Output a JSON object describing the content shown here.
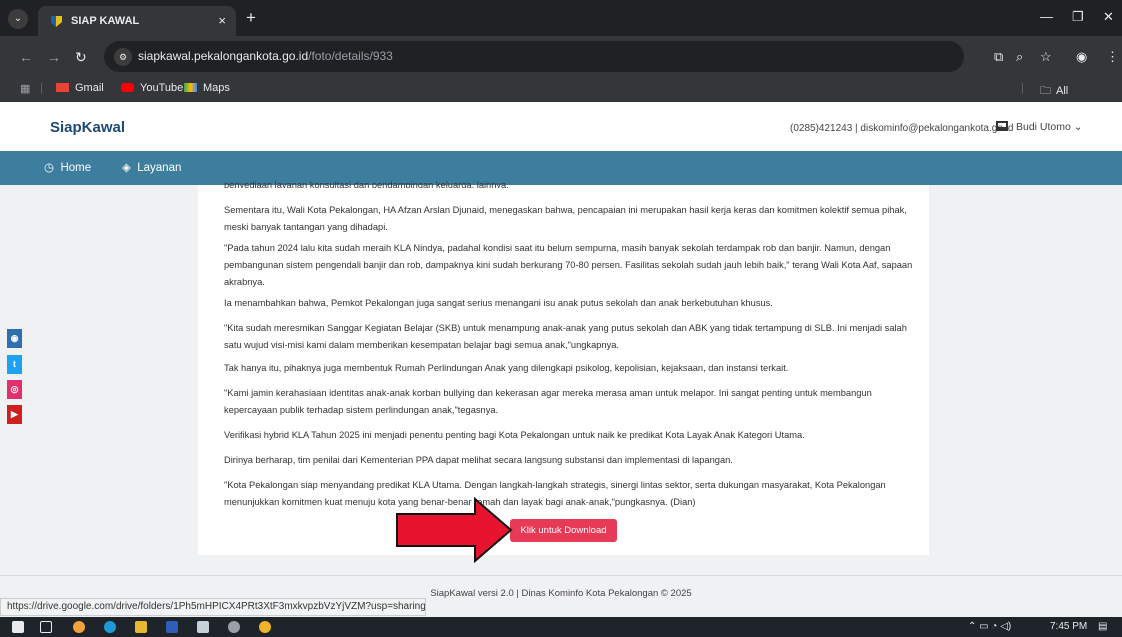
{
  "browser": {
    "tab_title": "SIAP KAWAL",
    "url_host": "siapkawal.pekalongankota.go.id",
    "url_path": "/foto/details/933",
    "bookmarks": [
      "Gmail",
      "YouTube",
      "Maps"
    ],
    "all_bookmarks": "All Bookmarks",
    "icons": [
      "tab-search-icon",
      "close-icon",
      "new-tab-icon",
      "minimize-icon",
      "restore-icon",
      "back-icon",
      "forward-icon",
      "reload-icon",
      "site-info-icon",
      "translate-icon",
      "zoom-icon",
      "star-icon",
      "profile-icon",
      "menu-icon",
      "apps-grid-icon",
      "folder-icon"
    ]
  },
  "site": {
    "brand": "SiapKawal",
    "contact": "(0285)421243 | diskominfo@pekalongankota.go.id",
    "user": "Budi Utomo",
    "nav": [
      "Home",
      "Layanan"
    ]
  },
  "article": {
    "cut_top": "penyediaan layanan konsultasi dan pendampingan keluarga, lainnya.",
    "paragraphs": [
      "Sementara itu, Wali Kota Pekalongan, HA Afzan Arslan Djunaid, menegaskan bahwa, pencapaian ini merupakan hasil kerja keras dan komitmen kolektif semua pihak, meski banyak tantangan yang dihadapi.",
      "\"Pada tahun 2024 lalu kita sudah meraih KLA Nindya, padahal kondisi saat itu belum sempurna, masih banyak sekolah terdampak rob dan banjir. Namun, dengan pembangunan sistem pengendali banjir dan rob, dampaknya kini sudah berkurang 70-80 persen. Fasilitas sekolah sudah jauh lebih baik,\" terang Wali Kota Aaf, sapaan akrabnya.",
      "Ia menambahkan bahwa, Pemkot Pekalongan juga sangat serius menangani isu anak putus sekolah dan anak berkebutuhan khusus.",
      "\"Kita sudah meresmikan Sanggar Kegiatan Belajar (SKB) untuk menampung anak-anak yang putus sekolah dan ABK yang tidak tertampung di SLB. Ini menjadi salah satu wujud visi-misi kami dalam memberikan kesempatan belajar bagi semua anak,\"ungkapnya.",
      "Tak hanya itu, pihaknya juga membentuk Rumah Perlindungan Anak yang dilengkapi psikolog, kepolisian, kejaksaan, dan instansi terkait.",
      "\"Kami jamin kerahasiaan identitas anak-anak korban bullying dan kekerasan agar mereka merasa aman untuk melapor. Ini sangat penting untuk membangun kepercayaan publik terhadap sistem perlindungan anak,\"tegasnya.",
      "Verifikasi hybrid KLA Tahun 2025 ini menjadi penentu penting bagi Kota Pekalongan untuk naik ke predikat Kota Layak Anak Kategori Utama.",
      "Dirinya berharap, tim penilai dari Kementerian PPA dapat melihat secara langsung substansi dan implementasi di lapangan.",
      "\"Kota Pekalongan siap menyandang predikat KLA Utama. Dengan langkah-langkah strategis, sinergi lintas sektor, serta dukungan masyarakat, Kota Pekalongan menunjukkan komitmen kuat menuju kota yang benar-benar ramah dan layak bagi anak-anak,\"pungkasnya. (Dian)"
    ],
    "download_label": "Klik untuk Download"
  },
  "social": {
    "icons": [
      "website-icon",
      "twitter-icon",
      "instagram-icon",
      "youtube-icon"
    ],
    "colors": [
      "#2f6fb0",
      "#1da1f2",
      "#e1306c",
      "#cd201f"
    ]
  },
  "footer": "SiapKawal versi 2.0 | Dinas Kominfo Kota Pekalongan © 2025",
  "status_url": "https://drive.google.com/drive/folders/1Ph5mHPICX4PRt3XtF3mxkvpzbVzYjVZM?usp=sharing",
  "taskbar": {
    "time": "7:45 PM",
    "icons": [
      "start-icon",
      "task-view-icon",
      "chrome-icon",
      "edge-icon",
      "explorer-icon",
      "word-icon",
      "app-icon",
      "settings-icon",
      "chrome-dev-icon"
    ]
  },
  "colors": {
    "navbar": "#3d7e9e",
    "brand": "#1e4a76",
    "download": "#e63a56",
    "arrow": "#e8132f"
  }
}
